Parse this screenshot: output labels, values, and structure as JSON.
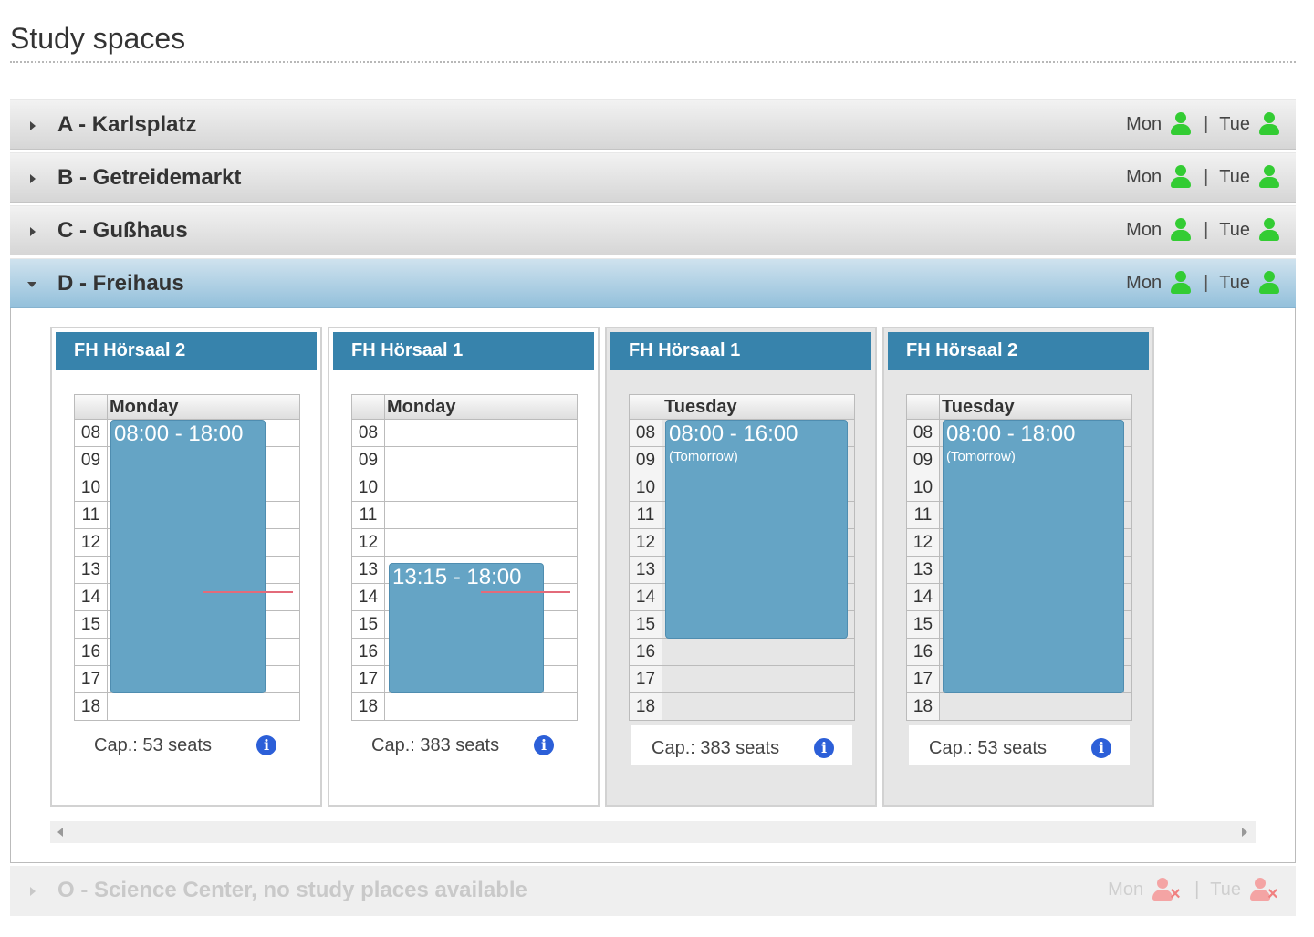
{
  "page_title": "Study spaces",
  "colors": {
    "accent": "#3783ac",
    "booking": "#65a4c5",
    "available": "#33cc33",
    "unavailable": "#f4a4a4",
    "now_line": "#e36b7a",
    "info": "#2c5fd8"
  },
  "sections": [
    {
      "label": "A - Karlsplatz",
      "state": "collapsed",
      "days": [
        {
          "label": "Mon",
          "status": "available"
        },
        {
          "label": "Tue",
          "status": "available"
        }
      ]
    },
    {
      "label": "B - Getreidemarkt",
      "state": "collapsed",
      "days": [
        {
          "label": "Mon",
          "status": "available"
        },
        {
          "label": "Tue",
          "status": "available"
        }
      ]
    },
    {
      "label": "C - Gußhaus",
      "state": "collapsed",
      "days": [
        {
          "label": "Mon",
          "status": "available"
        },
        {
          "label": "Tue",
          "status": "available"
        }
      ]
    },
    {
      "label": "D - Freihaus",
      "state": "expanded",
      "days": [
        {
          "label": "Mon",
          "status": "available"
        },
        {
          "label": "Tue",
          "status": "available"
        }
      ]
    },
    {
      "label": "O - Science Center, no study places available",
      "state": "disabled",
      "days": [
        {
          "label": "Mon",
          "status": "unavailable"
        },
        {
          "label": "Tue",
          "status": "unavailable"
        }
      ]
    }
  ],
  "separator": "|",
  "hours": [
    "08",
    "09",
    "10",
    "11",
    "12",
    "13",
    "14",
    "15",
    "16",
    "17",
    "18"
  ],
  "rooms": [
    {
      "name": "FH Hörsaal 2",
      "day": "Monday",
      "booking": {
        "time": "08:00 - 18:00",
        "note": ""
      },
      "capacity": "Cap.: 53 seats",
      "now_line": true
    },
    {
      "name": "FH Hörsaal 1",
      "day": "Monday",
      "booking": {
        "time": "13:15 - 18:00",
        "note": ""
      },
      "capacity": "Cap.: 383 seats",
      "now_line": true
    },
    {
      "name": "FH Hörsaal 1",
      "day": "Tuesday",
      "booking": {
        "time": "08:00 - 16:00",
        "note": "(Tomorrow)"
      },
      "capacity": "Cap.: 383 seats",
      "now_line": false
    },
    {
      "name": "FH Hörsaal 2",
      "day": "Tuesday",
      "booking": {
        "time": "08:00 - 18:00",
        "note": "(Tomorrow)"
      },
      "capacity": "Cap.: 53 seats",
      "now_line": false
    }
  ],
  "info_icon": "info-icon"
}
